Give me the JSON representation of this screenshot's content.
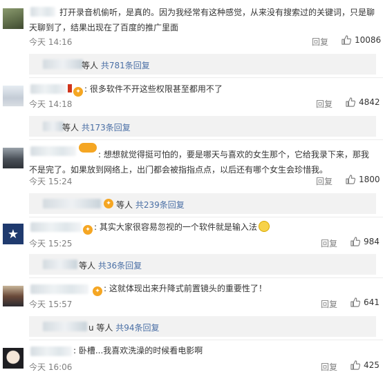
{
  "comments": [
    {
      "text": "打开录音机偷听，是真的。因为我经常有这种感觉，从来没有搜索过的关键词，只是聊天聊到了，结果出现在了百度的推广里面",
      "time": "今天 14:16",
      "reply_label": "回复",
      "likes": "10086",
      "sub_prefix": "等人",
      "sub_count": "共781条回复"
    },
    {
      "text": "很多软件不开这些权限甚至都用不了",
      "time": "今天 14:18",
      "reply_label": "回复",
      "likes": "4842",
      "sub_prefix": "等人",
      "sub_count": "共173条回复"
    },
    {
      "badge": "铁粉",
      "text": "想想就觉得挺可怕的，要是哪天与喜欢的女生那个，它给我录下来，那我不是完了。如果放到网络上，出门都会被指指点点，以后还有哪个女生会珍惜我。",
      "time": "今天 15:24",
      "reply_label": "回复",
      "likes": "1800",
      "sub_prefix": "等人",
      "sub_count": "共239条回复"
    },
    {
      "text": "其实大家很容易忽视的一个软件就是输入法",
      "time": "今天 15:25",
      "reply_label": "回复",
      "likes": "984",
      "sub_prefix": "等人",
      "sub_count": "共36条回复"
    },
    {
      "text": "这就体现出来升降式前置镜头的重要性了！",
      "time": "今天 15:57",
      "reply_label": "回复",
      "likes": "641",
      "sub_prefix": "u 等人",
      "sub_count": "共94条回复"
    },
    {
      "text": "卧槽...我喜欢洗澡的时候看电影啊",
      "time": "今天 16:06",
      "reply_label": "回复",
      "likes": "425"
    }
  ]
}
